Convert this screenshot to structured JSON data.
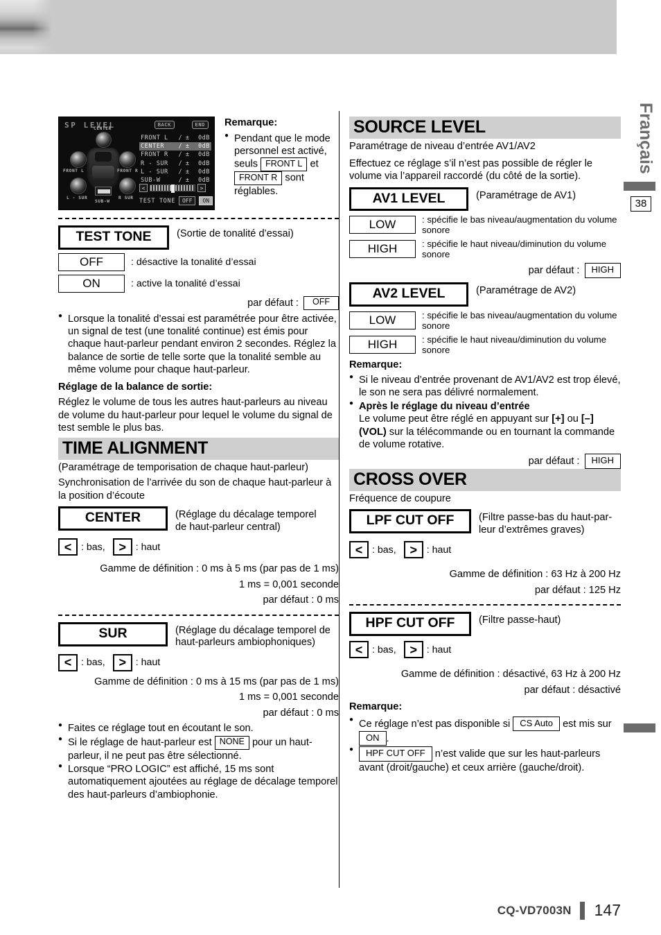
{
  "page": {
    "language_tab": "Français",
    "page_ref": "38",
    "footer_model": "CQ-VD7003N",
    "footer_page": "147"
  },
  "device_screen": {
    "title": "SP LEVEL",
    "back_button": "BACK",
    "end_button": "END",
    "speaker_labels": {
      "center": "CENTER",
      "front_l": "FRONT L",
      "front_r": "FRONT R",
      "l_sur": "L - SUR",
      "r_sur": "R SUR",
      "sub_w": "SUB-W"
    },
    "level_rows": [
      {
        "name": "FRONT L",
        "slash": "/",
        "sign": "±",
        "value": "0dB",
        "selected": false
      },
      {
        "name": "CENTER",
        "slash": "/",
        "sign": "±",
        "value": "0dB",
        "selected": true
      },
      {
        "name": "FRONT R",
        "slash": "/",
        "sign": "±",
        "value": "0dB",
        "selected": false
      },
      {
        "name": "R - SUR",
        "slash": "/",
        "sign": "±",
        "value": "0dB",
        "selected": false
      },
      {
        "name": "L - SUR",
        "slash": "/",
        "sign": "±",
        "value": "0dB",
        "selected": false
      },
      {
        "name": "SUB-W",
        "slash": "/",
        "sign": "±",
        "value": "0dB",
        "selected": false
      }
    ],
    "slider_left": "<",
    "slider_right": ">",
    "test_tone_label": "TEST TONE",
    "test_tone_off": "OFF",
    "test_tone_on": "ON"
  },
  "note_top": {
    "heading": "Remarque:",
    "line1": "Pendant que le mode",
    "line2": "personnel est activé,",
    "line3_pre": "seuls",
    "key1": "FRONT L",
    "line3_post": "et",
    "key2": "FRONT R",
    "line4_post": "sont",
    "line5": "réglables."
  },
  "test_tone": {
    "title": "TEST TONE",
    "subtitle": "(Sortie de tonalité d’essai)",
    "options": [
      {
        "label": "OFF",
        "desc": ": désactive la tonalité d’essai"
      },
      {
        "label": "ON",
        "desc": ": active la tonalité d’essai"
      }
    ],
    "default_label": "par défaut :",
    "default_value": "OFF",
    "bullet": "Lorsque la tonalité d’essai est paramétrée pour être activée, un signal de test (une tonalité continue) est émis pour chaque haut-parleur pendant environ 2 secondes. Réglez la balance de sortie de telle sorte que la tonalité semble au même volume pour chaque haut-parleur.",
    "balance_heading": "Réglage de la balance de sortie:",
    "balance_text": "Réglez le volume de tous les autres haut-parleurs au niveau de volume du haut-parleur pour lequel le volume du signal de test semble le plus bas."
  },
  "time_alignment": {
    "title": "TIME ALIGNMENT",
    "subtitle": "(Paramétrage de temporisation de chaque haut-parleur)",
    "intro": "Synchronisation de l’arrivée du son de chaque haut-parleur à la position d’écoute",
    "center": {
      "label": "CENTER",
      "desc_line1": "(Réglage du décalage temporel",
      "desc_line2": "de haut-parleur central)",
      "arrow_left": "<",
      "arrow_left_desc": ": bas,",
      "arrow_right": ">",
      "arrow_right_desc": ": haut",
      "range": "Gamme de définition : 0 ms à 5 ms (par pas de 1 ms)",
      "unit": "1 ms = 0,001 seconde",
      "default": "par défaut : 0 ms"
    },
    "sur": {
      "label": "SUR",
      "desc_line1": "(Réglage du décalage temporel de",
      "desc_line2": "haut-parleurs ambiophoniques)",
      "arrow_left": "<",
      "arrow_left_desc": ": bas,",
      "arrow_right": ">",
      "arrow_right_desc": ": haut",
      "range": "Gamme de définition : 0 ms à 15 ms (par pas de 1 ms)",
      "unit": "1 ms = 0,001 seconde",
      "default": "par défaut : 0 ms"
    },
    "notes": [
      {
        "pre": "Faites ce réglage tout en écoutant le son.",
        "key": null,
        "post": null
      },
      {
        "pre": "Si le réglage de haut-parleur est",
        "key": "NONE",
        "post": "pour un haut-parleur, il ne peut pas être sélectionné."
      },
      {
        "pre": "Lorsque “PRO LOGIC” est affiché, 15 ms sont automatiquement ajoutées au réglage de décalage temporel des haut-parleurs d’ambiophonie.",
        "key": null,
        "post": null
      }
    ]
  },
  "source_level": {
    "title": "SOURCE LEVEL",
    "subtitle": "Paramétrage de niveau d’entrée AV1/AV2",
    "intro": "Effectuez ce réglage s’il n’est pas possible de régler le volume via l’appareil raccordé (du côté de la sortie).",
    "av1": {
      "label": "AV1 LEVEL",
      "desc": "(Paramétrage de AV1)",
      "options": [
        {
          "label": "LOW",
          "desc": ": spécifie le bas niveau/augmentation du volume sonore"
        },
        {
          "label": "HIGH",
          "desc": ": spécifie le haut niveau/diminution du volume sonore"
        }
      ],
      "default_label": "par défaut :",
      "default_value": "HIGH"
    },
    "av2": {
      "label": "AV2 LEVEL",
      "desc": "(Paramétrage de AV2)",
      "options": [
        {
          "label": "LOW",
          "desc": ": spécifie le bas niveau/augmentation du volume sonore"
        },
        {
          "label": "HIGH",
          "desc": ": spécifie le haut niveau/diminution du volume sonore"
        }
      ],
      "default_label": "par défaut :",
      "default_value": "HIGH"
    },
    "note_heading": "Remarque:",
    "note1": "Si le niveau d’entrée provenant de AV1/AV2 est trop élevé, le son ne sera pas délivré normalement.",
    "note2_heading": "Après le réglage du niveau d’entrée",
    "note2_part1": "Le volume peut être réglé en appuyant sur ",
    "note2_plus": "[+]",
    "note2_or": " ou ",
    "note2_minus": "[–]",
    "note2_vol": "(VOL)",
    "note2_part2": " sur la télécommande ou en tournant la commande de volume rotative."
  },
  "cross_over": {
    "title": "CROSS OVER",
    "subtitle": "Fréquence de coupure",
    "lpf": {
      "label": "LPF CUT OFF",
      "desc_line1": "(Filtre passe-bas du haut-par-",
      "desc_line2": "leur d’extrêmes graves)",
      "arrow_left": "<",
      "arrow_left_desc": ": bas,",
      "arrow_right": ">",
      "arrow_right_desc": ": haut",
      "range": "Gamme de définition : 63 Hz à 200 Hz",
      "default": "par défaut : 125 Hz"
    },
    "hpf": {
      "label": "HPF CUT OFF",
      "desc": "(Filtre passe-haut)",
      "arrow_left": "<",
      "arrow_left_desc": ": bas,",
      "arrow_right": ">",
      "arrow_right_desc": ": haut",
      "range": "Gamme de définition : désactivé, 63 Hz à 200 Hz",
      "default": "par défaut : désactivé"
    },
    "note_heading": "Remarque:",
    "note1_pre": "Ce réglage n’est pas disponible si",
    "note1_key": "CS Auto",
    "note1_mid": "est mis sur",
    "note1_key2": "ON",
    "note1_post": ".",
    "note2_key": "HPF CUT OFF",
    "note2_post": "n’est valide que sur les haut-parleurs avant (droit/gauche) et ceux arrière (gauche/droit)."
  }
}
